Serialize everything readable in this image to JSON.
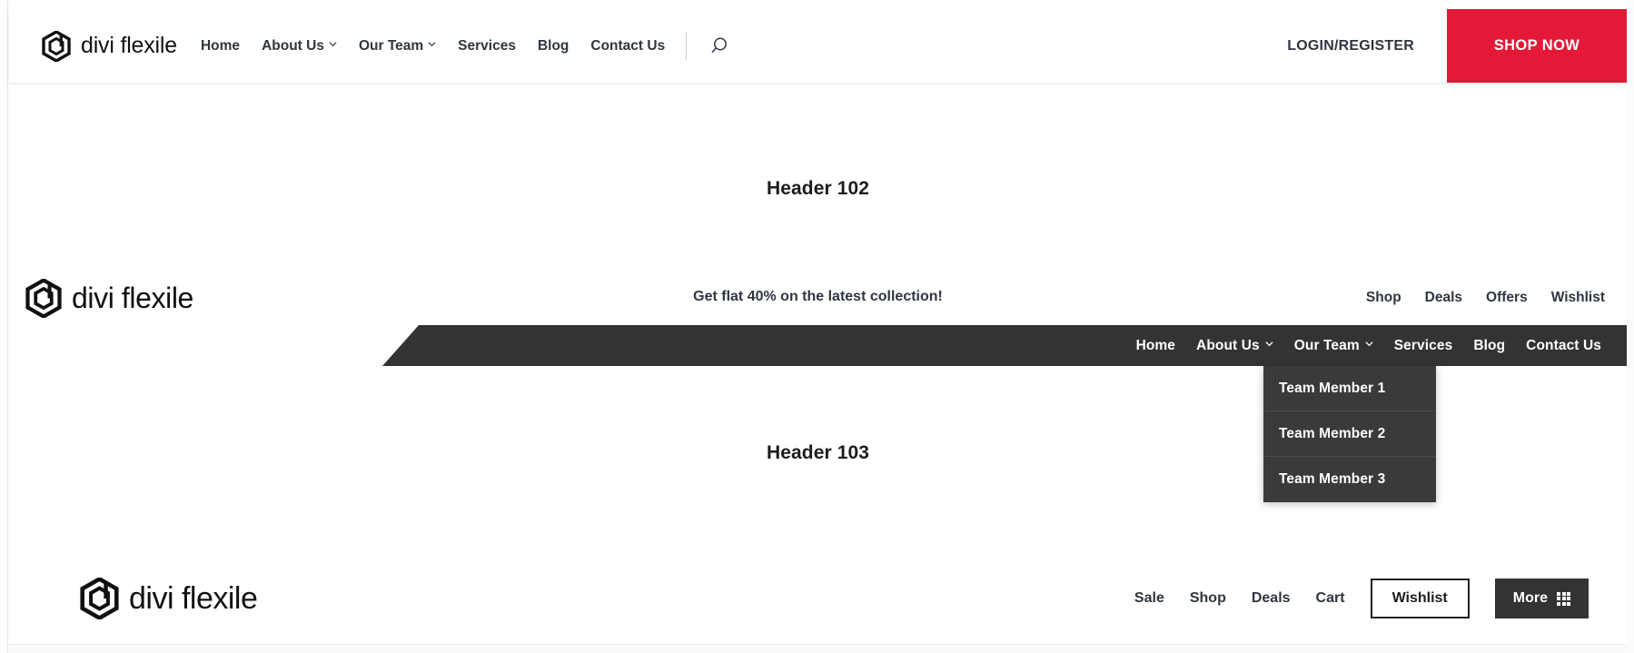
{
  "brand": {
    "name": "divi flexile",
    "logo_icon": "hexagon-d-logo"
  },
  "header102": {
    "section_label": "Header 102",
    "nav": [
      {
        "label": "Home",
        "has_caret": false
      },
      {
        "label": "About Us",
        "has_caret": true
      },
      {
        "label": "Our Team",
        "has_caret": true
      },
      {
        "label": "Services",
        "has_caret": false
      },
      {
        "label": "Blog",
        "has_caret": false
      },
      {
        "label": "Contact Us",
        "has_caret": false
      }
    ],
    "search_icon": "search-icon",
    "login_label": "LOGIN/REGISTER",
    "shop_now_label": "SHOP NOW",
    "shop_now_color": "#e31937"
  },
  "header103": {
    "section_label": "Header 103",
    "promo_text": "Get flat 40% on the latest collection!",
    "top_links": [
      "Shop",
      "Deals",
      "Offers",
      "Wishlist"
    ],
    "nav": [
      {
        "label": "Home",
        "has_caret": false
      },
      {
        "label": "About Us",
        "has_caret": true
      },
      {
        "label": "Our Team",
        "has_caret": true
      },
      {
        "label": "Services",
        "has_caret": false
      },
      {
        "label": "Blog",
        "has_caret": false
      },
      {
        "label": "Contact Us",
        "has_caret": false
      }
    ],
    "navbar_color": "#333333",
    "dropdown": {
      "parent": "Our Team",
      "items": [
        "Team Member 1",
        "Team Member 2",
        "Team Member 3"
      ]
    }
  },
  "header104": {
    "links": [
      "Sale",
      "Shop",
      "Deals",
      "Cart"
    ],
    "wishlist_label": "Wishlist",
    "more_label": "More",
    "more_icon": "grid-icon",
    "more_button_color": "#333333"
  }
}
